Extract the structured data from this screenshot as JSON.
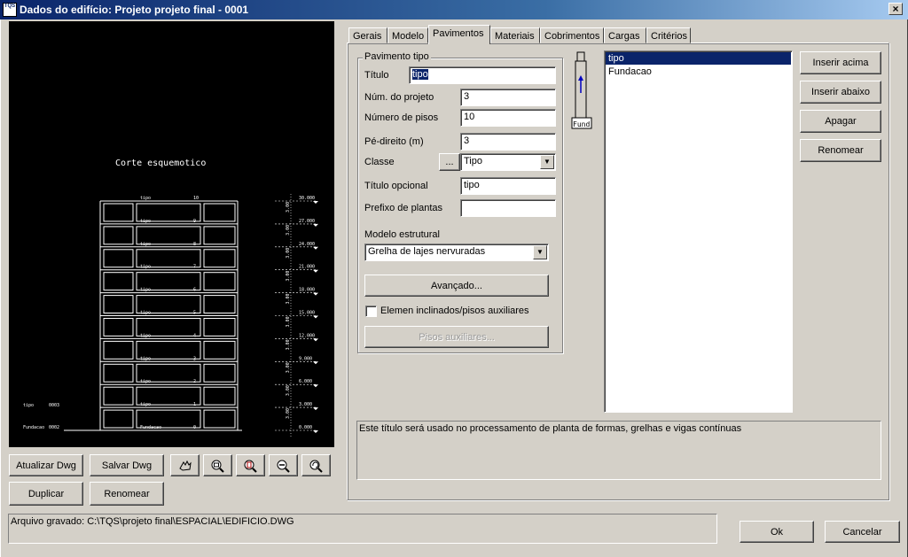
{
  "window": {
    "title": "Dados do edifício: Projeto projeto final - 0001",
    "app_icon_text": "TQS",
    "close_glyph": "×"
  },
  "preview": {
    "heading": "Corte esquemotico",
    "floors": [
      {
        "name": "tipo",
        "number": "10"
      },
      {
        "name": "tipo",
        "number": "9"
      },
      {
        "name": "tipo",
        "number": "8"
      },
      {
        "name": "tipo",
        "number": "7"
      },
      {
        "name": "tipo",
        "number": "6"
      },
      {
        "name": "tipo",
        "number": "5"
      },
      {
        "name": "tipo",
        "number": "4"
      },
      {
        "name": "tipo",
        "number": "3"
      },
      {
        "name": "tipo",
        "number": "2"
      },
      {
        "name": "tipo",
        "number": "1"
      },
      {
        "name": "Fundacao",
        "number": "0"
      }
    ],
    "elevations": [
      "30.000",
      "27.000",
      "24.000",
      "21.000",
      "18.000",
      "15.000",
      "12.000",
      "9.000",
      "6.000",
      "3.000",
      "0.000"
    ],
    "spans": [
      "3.00",
      "3.00",
      "3.00",
      "3.00",
      "3.00",
      "3.00",
      "3.00",
      "3.00",
      "3.00",
      "3.00"
    ],
    "left_labels": [
      {
        "name": "tipo",
        "code": "0003"
      },
      {
        "name": "Fundacao",
        "code": "0002"
      }
    ]
  },
  "left_buttons": {
    "atualizar": "Atualizar Dwg",
    "salvar": "Salvar Dwg",
    "duplicar": "Duplicar",
    "renomear": "Renomear"
  },
  "zoom_icons": [
    "pan-icon",
    "zoom-window-icon",
    "zoom-extents-icon",
    "zoom-out-icon",
    "zoom-previous-icon"
  ],
  "tabs": [
    "Gerais",
    "Modelo",
    "Pavimentos",
    "Materiais",
    "Cobrimentos",
    "Cargas",
    "Critérios"
  ],
  "active_tab": "Pavimentos",
  "form": {
    "group_title": "Pavimento tipo",
    "titulo_label": "Título",
    "titulo_value": "tipo",
    "num_projeto_label": "Núm. do projeto",
    "num_projeto_value": "3",
    "num_pisos_label": "Número de pisos",
    "num_pisos_value": "10",
    "pe_direito_label": "Pé-direito (m)",
    "pe_direito_value": "3",
    "classe_label": "Classe",
    "classe_btn": "...",
    "classe_value": "Tipo",
    "titulo_opcional_label": "Título opcional",
    "titulo_opcional_value": "tipo",
    "prefixo_label": "Prefixo de plantas",
    "prefixo_value": "",
    "modelo_label": "Modelo estrutural",
    "modelo_value": "Grelha de lajes nervuradas",
    "avancado_btn": "Avançado...",
    "elem_label": "Elemen inclinados/pisos auxiliares",
    "pisos_aux_btn": "Pisos auxiliares..."
  },
  "mini_building": {
    "label": "Fund"
  },
  "floor_list": [
    "tipo",
    "Fundacao"
  ],
  "list_buttons": {
    "inserir_acima": "Inserir acima",
    "inserir_abaixo": "Inserir abaixo",
    "apagar": "Apagar",
    "renomear": "Renomear"
  },
  "help_text": "Este título será usado no processamento de planta de formas, grelhas e vigas contínuas",
  "status": "Arquivo gravado: C:\\TQS\\projeto final\\ESPACIAL\\EDIFICIO.DWG",
  "footer": {
    "ok": "Ok",
    "cancel": "Cancelar"
  }
}
